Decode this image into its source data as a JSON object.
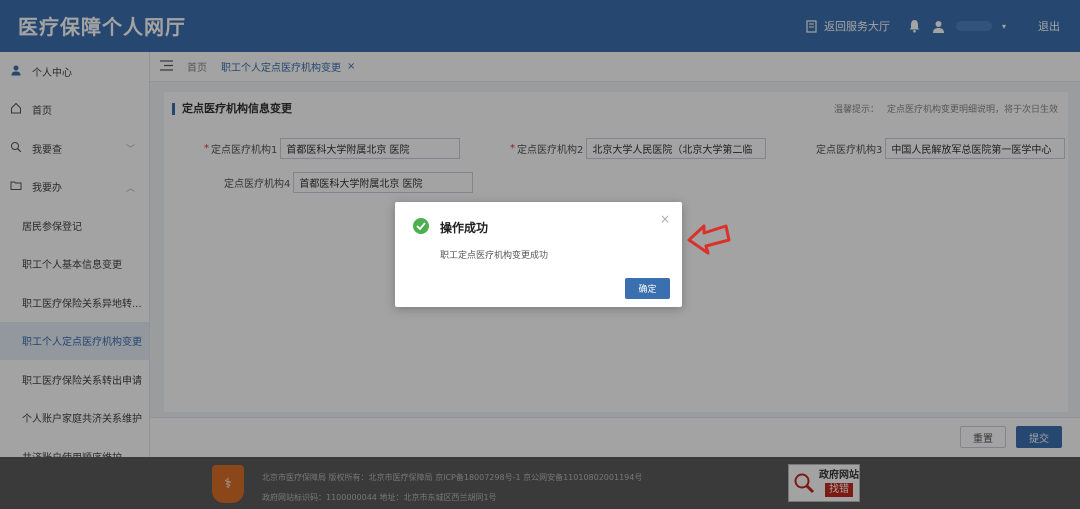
{
  "header": {
    "title": "医疗保障个人网厅",
    "service_hall": "返回服务大厅",
    "logout": "退出"
  },
  "sidebar": {
    "items": [
      {
        "label": "个人中心",
        "icon": "user-icon"
      },
      {
        "label": "首页",
        "icon": "home-icon"
      },
      {
        "label": "我要查",
        "icon": "search-icon"
      },
      {
        "label": "我要办",
        "icon": "folder-icon"
      }
    ],
    "sub_items": [
      {
        "label": "居民参保登记"
      },
      {
        "label": "职工个人基本信息变更"
      },
      {
        "label": "职工医疗保险关系异地转..."
      },
      {
        "label": "职工个人定点医疗机构变更",
        "active": true
      },
      {
        "label": "职工医疗保险关系转出申请"
      },
      {
        "label": "个人账户家庭共济关系维护"
      },
      {
        "label": "共济账户使用顺序维护"
      }
    ]
  },
  "tabs": {
    "home": "首页",
    "active": "职工个人定点医疗机构变更",
    "close": "×"
  },
  "form": {
    "title": "定点医疗机构信息变更",
    "hint_label": "温馨提示：",
    "hint_text": "定点医疗机构变更明细说明，将于次日生效",
    "fields": [
      {
        "label": "定点医疗机构1",
        "required": "*",
        "value": "首都医科大学附属北京    医院"
      },
      {
        "label": "定点医疗机构2",
        "required": "*",
        "value": "北京大学人民医院（北京大学第二临"
      },
      {
        "label": "定点医疗机构3",
        "required": "",
        "value": "中国人民解放军总医院第一医学中心"
      },
      {
        "label": "定点医疗机构4",
        "required": "",
        "value": "首都医科大学附属北京    医院"
      }
    ],
    "reset": "重置",
    "submit": "提交"
  },
  "dialog": {
    "title": "操作成功",
    "message": "职工定点医疗机构变更成功",
    "confirm": "确定",
    "close": "×"
  },
  "footer": {
    "line1": "北京市医疗保障局    版权所有：北京市医疗保障局    京ICP备18007298号-1    京公网安备11010802001194号",
    "line2": "政府网站标识码：1100000044    地址：北京市东城区西兰胡同1号",
    "gov_badge_line1": "政府网站",
    "gov_badge_line2": "找错"
  },
  "colors": {
    "primary": "#3a6fb0",
    "success": "#4caf50",
    "annotation": "#d9322b",
    "footer_bg": "#5b5b5b"
  }
}
